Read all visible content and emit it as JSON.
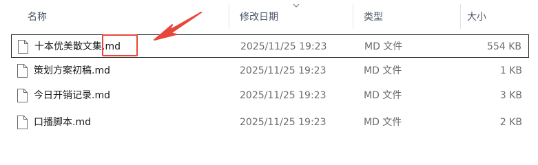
{
  "columns": {
    "name": "名称",
    "modified": "修改日期",
    "type": "类型",
    "size": "大小"
  },
  "files": [
    {
      "name": "十本优美散文集.md",
      "modified": "2025/11/25 19:23",
      "type": "MD 文件",
      "size": "554 KB",
      "selected": true
    },
    {
      "name": "策划方案初稿.md",
      "modified": "2025/11/25 19:23",
      "type": "MD 文件",
      "size": "1 KB",
      "selected": false
    },
    {
      "name": "今日开销记录.md",
      "modified": "2025/11/25 19:23",
      "type": "MD 文件",
      "size": "3 KB",
      "selected": false
    },
    {
      "name": "口播脚本.md",
      "modified": "2025/11/25 19:23",
      "type": "MD 文件",
      "size": "2 KB",
      "selected": false
    }
  ],
  "annotation": {
    "color": "#e8463a",
    "target": "file extension .md of first file"
  }
}
